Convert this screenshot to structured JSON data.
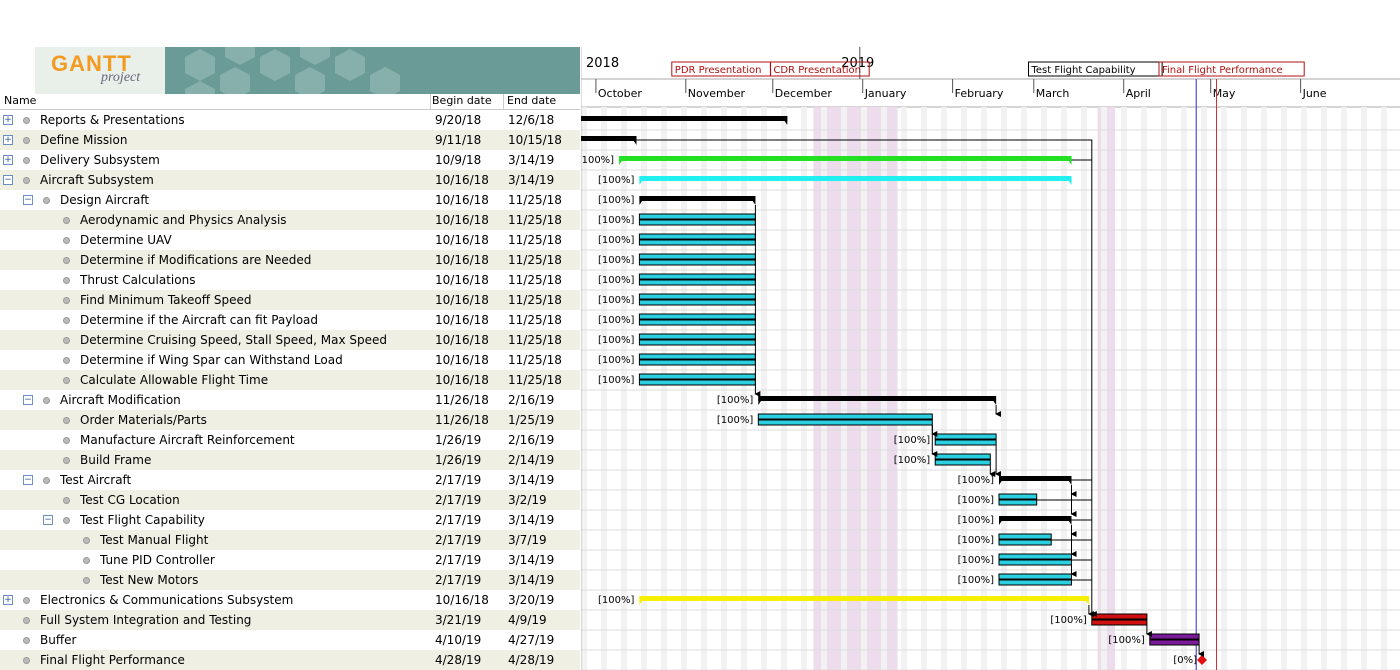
{
  "columns": {
    "name": "Name",
    "begin": "Begin date",
    "end": "End date"
  },
  "logo": {
    "main": "GANTT",
    "sub": "project"
  },
  "chart": {
    "years": [
      "2018",
      "2019"
    ],
    "months": [
      "October",
      "November",
      "December",
      "January",
      "February",
      "March",
      "April",
      "May",
      "June"
    ],
    "milestone_labels": [
      "PDR Presentation",
      "CDR Presentation",
      "Test Flight Capability",
      "Final Flight Performance"
    ]
  },
  "tasks": [
    {
      "name": "Reports & Presentations",
      "begin": "9/20/18",
      "end": "12/6/18",
      "pct": "",
      "expander": "+"
    },
    {
      "name": "Define Mission",
      "begin": "9/11/18",
      "end": "10/15/18",
      "pct": "",
      "expander": "+"
    },
    {
      "name": "Delivery Subsystem",
      "begin": "10/9/18",
      "end": "3/14/19",
      "pct": "100%]",
      "expander": "+"
    },
    {
      "name": "Aircraft Subsystem",
      "begin": "10/16/18",
      "end": "3/14/19",
      "pct": "[100%]",
      "expander": "−"
    },
    {
      "name": "Design Aircraft",
      "begin": "10/16/18",
      "end": "11/25/18",
      "pct": "[100%]",
      "expander": "−"
    },
    {
      "name": "Aerodynamic and Physics Analysis",
      "begin": "10/16/18",
      "end": "11/25/18",
      "pct": "[100%]",
      "expander": ""
    },
    {
      "name": "Determine UAV",
      "begin": "10/16/18",
      "end": "11/25/18",
      "pct": "[100%]",
      "expander": ""
    },
    {
      "name": "Determine if Modifications are Needed",
      "begin": "10/16/18",
      "end": "11/25/18",
      "pct": "[100%]",
      "expander": ""
    },
    {
      "name": "Thrust Calculations",
      "begin": "10/16/18",
      "end": "11/25/18",
      "pct": "[100%]",
      "expander": ""
    },
    {
      "name": "Find Minimum Takeoff Speed",
      "begin": "10/16/18",
      "end": "11/25/18",
      "pct": "[100%]",
      "expander": ""
    },
    {
      "name": "Determine if the Aircraft can fit Payload",
      "begin": "10/16/18",
      "end": "11/25/18",
      "pct": "[100%]",
      "expander": ""
    },
    {
      "name": "Determine Cruising Speed, Stall Speed, Max Speed",
      "begin": "10/16/18",
      "end": "11/25/18",
      "pct": "[100%]",
      "expander": ""
    },
    {
      "name": "Determine if Wing Spar can Withstand Load",
      "begin": "10/16/18",
      "end": "11/25/18",
      "pct": "[100%]",
      "expander": ""
    },
    {
      "name": "Calculate Allowable Flight Time",
      "begin": "10/16/18",
      "end": "11/25/18",
      "pct": "[100%]",
      "expander": ""
    },
    {
      "name": "Aircraft Modification",
      "begin": "11/26/18",
      "end": "2/16/19",
      "pct": "[100%]",
      "expander": "−"
    },
    {
      "name": "Order Materials/Parts",
      "begin": "11/26/18",
      "end": "1/25/19",
      "pct": "[100%]",
      "expander": ""
    },
    {
      "name": "Manufacture Aircraft Reinforcement",
      "begin": "1/26/19",
      "end": "2/16/19",
      "pct": "[100%]",
      "expander": ""
    },
    {
      "name": "Build Frame",
      "begin": "1/26/19",
      "end": "2/14/19",
      "pct": "[100%]",
      "expander": ""
    },
    {
      "name": "Test Aircraft",
      "begin": "2/17/19",
      "end": "3/14/19",
      "pct": "[100%]",
      "expander": "−"
    },
    {
      "name": "Test CG Location",
      "begin": "2/17/19",
      "end": "3/2/19",
      "pct": "[100%]",
      "expander": ""
    },
    {
      "name": "Test Flight Capability",
      "begin": "2/17/19",
      "end": "3/14/19",
      "pct": "[100%]",
      "expander": "−"
    },
    {
      "name": "Test Manual Flight",
      "begin": "2/17/19",
      "end": "3/7/19",
      "pct": "[100%]",
      "expander": ""
    },
    {
      "name": "Tune PID Controller",
      "begin": "2/17/19",
      "end": "3/14/19",
      "pct": "[100%]",
      "expander": ""
    },
    {
      "name": "Test New Motors",
      "begin": "2/17/19",
      "end": "3/14/19",
      "pct": "[100%]",
      "expander": ""
    },
    {
      "name": "Electronics & Communications Subsystem",
      "begin": "10/16/18",
      "end": "3/20/19",
      "pct": "[100%]",
      "expander": "+"
    },
    {
      "name": "Full System Integration and Testing",
      "begin": "3/21/19",
      "end": "4/9/19",
      "pct": "[100%]",
      "expander": ""
    },
    {
      "name": "Buffer",
      "begin": "4/10/19",
      "end": "4/27/19",
      "pct": "[100%]",
      "expander": ""
    },
    {
      "name": "Final Flight Performance",
      "begin": "4/28/19",
      "end": "4/28/19",
      "pct": "[0%]",
      "expander": ""
    }
  ],
  "colors": {
    "summary": "#000000",
    "task": "#2ad0e0",
    "delivery": "#22e022",
    "aircraft": "#22f0f0",
    "electronics": "#f4f000",
    "integration": "#d01010",
    "buffer": "#7a1a9a",
    "milestone": "#e01010",
    "holiday": "#ecdcec",
    "today": "#2a2ad0"
  }
}
